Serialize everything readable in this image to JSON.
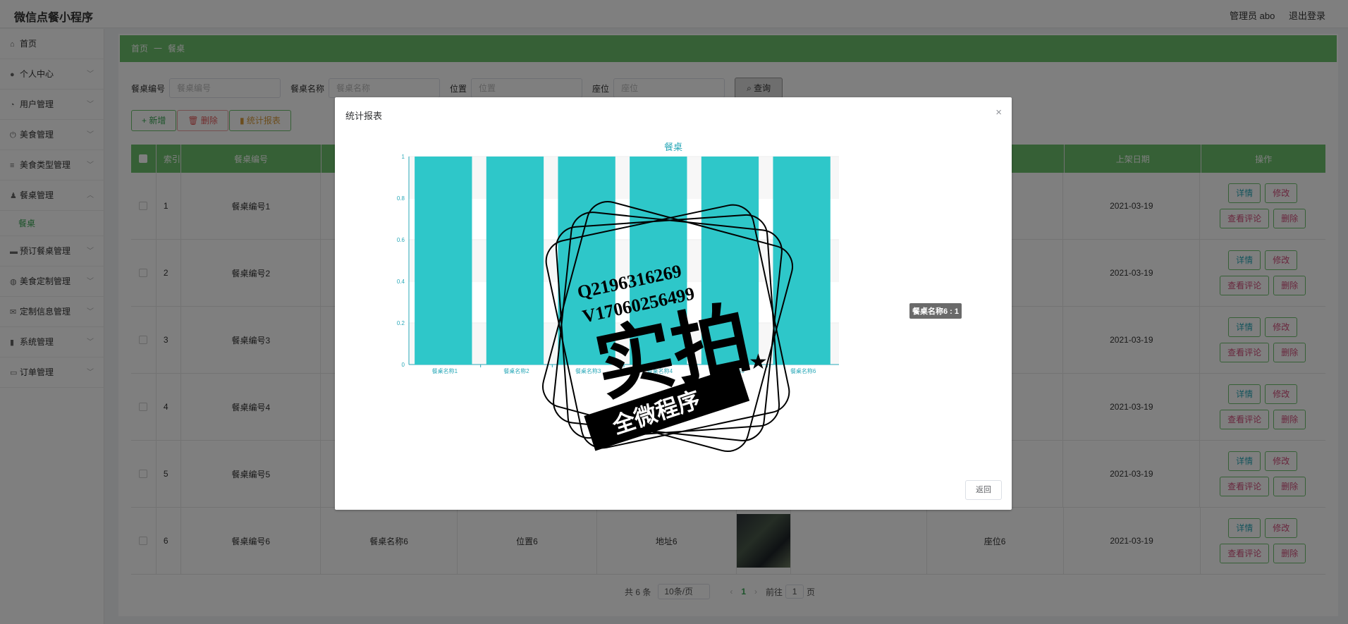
{
  "app": {
    "title": "微信点餐小程序",
    "admin_label": "管理员 abo",
    "logout_label": "退出登录"
  },
  "sidebar": {
    "items": [
      {
        "label": "首页",
        "icon": "home-icon"
      },
      {
        "label": "个人中心",
        "icon": "user-icon"
      },
      {
        "label": "用户管理",
        "icon": "bell-icon"
      },
      {
        "label": "美食管理",
        "icon": "power-icon"
      },
      {
        "label": "美食类型管理",
        "icon": "list-icon"
      },
      {
        "label": "餐桌管理",
        "icon": "person-icon",
        "expanded": true
      },
      {
        "label": "预订餐桌管理",
        "icon": "monitor-icon"
      },
      {
        "label": "美食定制管理",
        "icon": "palette-icon"
      },
      {
        "label": "定制信息管理",
        "icon": "mail-icon"
      },
      {
        "label": "系统管理",
        "icon": "chart-icon"
      },
      {
        "label": "订单管理",
        "icon": "chat-icon"
      }
    ],
    "sub_item": "餐桌"
  },
  "breadcrumb": {
    "home": "首页",
    "sep": "一",
    "current": "餐桌"
  },
  "search": {
    "fields": [
      {
        "label": "餐桌编号",
        "placeholder": "餐桌编号"
      },
      {
        "label": "餐桌名称",
        "placeholder": "餐桌名称"
      },
      {
        "label": "位置",
        "placeholder": "位置"
      },
      {
        "label": "座位",
        "placeholder": "座位"
      }
    ],
    "query_label": "查询"
  },
  "toolbar": {
    "add_label": "+ 新增",
    "delete_label": "删除",
    "stats_label": "统计报表"
  },
  "table": {
    "headers": [
      "",
      "索引",
      "餐桌编号",
      "",
      "",
      "",
      "",
      "",
      "",
      "上架日期",
      "操作"
    ],
    "rows": [
      {
        "index": "1",
        "code": "餐桌编号1",
        "date": "2021-03-19"
      },
      {
        "index": "2",
        "code": "餐桌编号2",
        "date": "2021-03-19"
      },
      {
        "index": "3",
        "code": "餐桌编号3",
        "date": "2021-03-19"
      },
      {
        "index": "4",
        "code": "餐桌编号4",
        "date": "2021-03-19"
      },
      {
        "index": "5",
        "code": "餐桌编号5",
        "date": "2021-03-19"
      },
      {
        "index": "6",
        "code": "餐桌编号6",
        "name": "餐桌名称6",
        "position": "位置6",
        "address": "地址6",
        "seat": "座位6",
        "date": "2021-03-19"
      }
    ],
    "ops": {
      "detail": "详情",
      "edit": "修改",
      "review": "查看评论",
      "remove": "删除"
    }
  },
  "pagination": {
    "total": "共 6 条",
    "page_size": "10条/页",
    "current_page": "1",
    "goto_prefix": "前往",
    "goto_value": "1",
    "goto_suffix": "页"
  },
  "dialog": {
    "title": "统计报表",
    "close": "×",
    "return_label": "返回",
    "tooltip": "餐桌名称6 : 1"
  },
  "stamp": {
    "line1": "Q2196316269",
    "line2": "V17060256499",
    "big": "实拍",
    "banner": "全微程序"
  },
  "colors": {
    "green": "#6cc16c",
    "bar": "#2ec7c9",
    "chart_title": "#2aa8b8"
  },
  "chart_data": {
    "type": "bar",
    "title": "餐桌",
    "categories": [
      "餐桌名称1",
      "餐桌名称2",
      "餐桌名称3",
      "餐桌名称4",
      "餐桌名称5",
      "餐桌名称6"
    ],
    "values": [
      1,
      1,
      1,
      1,
      1,
      1
    ],
    "ylim": [
      0,
      1
    ],
    "yticks": [
      0,
      0.2,
      0.4,
      0.6,
      0.8,
      1
    ],
    "grid": true
  }
}
